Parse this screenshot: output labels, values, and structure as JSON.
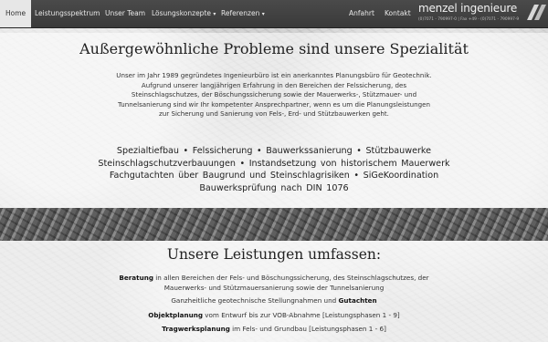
{
  "nav": {
    "items": [
      {
        "label": "Home",
        "active": true
      },
      {
        "label": "Leistungsspektrum"
      },
      {
        "label": "Unser Team"
      },
      {
        "label": "Lösungskonzepte",
        "dropdown": true
      },
      {
        "label": "Referenzen",
        "dropdown": true
      },
      {
        "label": "Anfahrt"
      },
      {
        "label": "Kontakt"
      }
    ],
    "caret": "▾"
  },
  "logo": {
    "name": "menzel ingenieure",
    "contact": "(0)7071 - 790997-0 | Fax +49 - (0)7071 - 790997-9",
    "edge_text": "Fon\n+49"
  },
  "intro": {
    "heading": "Außergewöhnliche Probleme sind unsere Spezialität",
    "lines": [
      "Unser im Jahr 1989 gegründetes Ingenieurbüro ist ein anerkanntes Planungsbüro für Geotechnik.",
      "Aufgrund unserer langjährigen Erfahrung in den Bereichen der Felssicherung, des",
      "Steinschlagschutzes, der Böschungssicherung sowie der Mauerwerks-, Stützmauer- und",
      "Tunnelsanierung sind wir Ihr kompetenter Ansprechpartner, wenn es um die Planungsleistungen",
      "zur Sicherung und Sanierung von Fels-, Erd- und Stützbauwerken geht."
    ]
  },
  "specialties": {
    "lines": [
      "Spezialtiefbau  •  Felssicherung  •  Bauwerkssanierung  •  Stützbauwerke",
      "Steinschlagschutzverbauungen  •  Instandsetzung von historischem Mauerwerk",
      "Fachgutachten über Baugrund und Steinschlagrisiken  •  SiGeKoordination",
      "Bauwerksprüfung nach DIN 1076"
    ]
  },
  "services": {
    "heading": "Unsere Leistungen umfassen:",
    "beratung_bold": "Beratung",
    "beratung_rest": " in allen Bereichen der Fels- und Böschungssicherung, des Steinschlagschutzes, der",
    "beratung_line2": "Mauerwerks- und Stützmauersanierung sowie der Tunnelsanierung",
    "gutachten_pre": "Ganzheitliche geotechnische Stellungnahmen und ",
    "gutachten_bold": "Gutachten",
    "objekt_bold": "Objektplanung",
    "objekt_rest": " vom Entwurf bis zur VOB-Abnahme [Leistungsphasen 1 - 9]",
    "trag_bold": "Tragwerksplanung",
    "trag_rest": " im Fels- und Grundbau [Leistungsphasen 1 - 6]"
  }
}
